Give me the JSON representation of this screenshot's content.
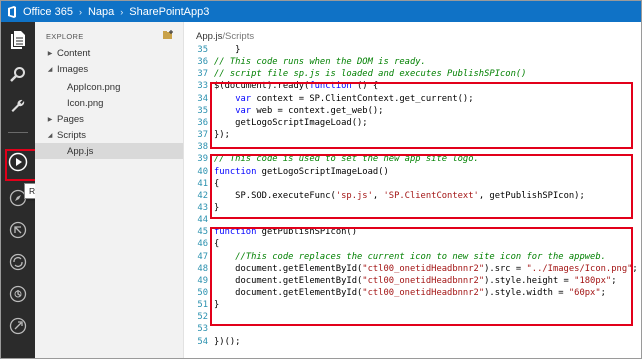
{
  "topbar": {
    "crumbs": [
      "Office 365",
      "Napa",
      "SharePointApp3"
    ]
  },
  "rail": {
    "icons": [
      "files-icon",
      "search-icon",
      "wrench-icon",
      "run-icon",
      "compass-icon",
      "publish-icon",
      "sync-icon",
      "history-icon",
      "settings-icon"
    ]
  },
  "explorer": {
    "title": "EXPLORE",
    "tree": [
      {
        "label": "Content",
        "arrow": "▶",
        "indent": 0
      },
      {
        "label": "Images",
        "arrow": "◢",
        "indent": 0
      },
      {
        "label": "AppIcon.png",
        "arrow": "",
        "indent": 1
      },
      {
        "label": "Icon.png",
        "arrow": "",
        "indent": 1
      },
      {
        "label": "Pages",
        "arrow": "▶",
        "indent": 0
      },
      {
        "label": "Scripts",
        "arrow": "◢",
        "indent": 0
      },
      {
        "label": "App.js",
        "arrow": "",
        "indent": 1,
        "selected": true
      }
    ]
  },
  "tooltip": "Run Project",
  "editor": {
    "file": "App.js",
    "path": "/Scripts",
    "lines": [
      {
        "n": "35",
        "segs": [
          [
            "",
            "    }"
          ]
        ]
      },
      {
        "n": "36",
        "segs": [
          [
            "cm",
            "// This code runs when the DOM is ready."
          ]
        ]
      },
      {
        "n": "37",
        "segs": [
          [
            "cm",
            "// script file sp.js is loaded and executes PublishSPIcon()"
          ]
        ]
      },
      {
        "n": "33",
        "segs": [
          [
            "",
            "$(document).ready("
          ],
          [
            "kw",
            "function"
          ],
          [
            "",
            " () {"
          ]
        ]
      },
      {
        "n": "34",
        "segs": [
          [
            "",
            "    "
          ],
          [
            "kw",
            "var"
          ],
          [
            "",
            " context = SP.ClientContext.get_current();"
          ]
        ]
      },
      {
        "n": "35",
        "segs": [
          [
            "",
            "    "
          ],
          [
            "kw",
            "var"
          ],
          [
            "",
            " web = context.get_web();"
          ]
        ]
      },
      {
        "n": "36",
        "segs": [
          [
            "",
            "    getLogoScriptImageLoad();"
          ]
        ]
      },
      {
        "n": "37",
        "segs": [
          [
            "",
            "});"
          ]
        ]
      },
      {
        "n": "38",
        "segs": [
          [
            "",
            ""
          ]
        ]
      },
      {
        "n": "39",
        "segs": [
          [
            "cm",
            "// This code is used to set the new app site logo."
          ]
        ]
      },
      {
        "n": "40",
        "segs": [
          [
            "kw",
            "function"
          ],
          [
            "",
            " getLogoScriptImageLoad()"
          ]
        ]
      },
      {
        "n": "41",
        "segs": [
          [
            "",
            "{"
          ]
        ]
      },
      {
        "n": "42",
        "segs": [
          [
            "",
            "    SP.SOD.executeFunc("
          ],
          [
            "str",
            "'sp.js'"
          ],
          [
            "",
            ", "
          ],
          [
            "str",
            "'SP.ClientContext'"
          ],
          [
            "",
            ", getPublishSPIcon);"
          ]
        ]
      },
      {
        "n": "43",
        "segs": [
          [
            "",
            "}"
          ]
        ]
      },
      {
        "n": "44",
        "segs": [
          [
            "",
            ""
          ]
        ]
      },
      {
        "n": "45",
        "segs": [
          [
            "kw",
            "function"
          ],
          [
            "",
            " getPublishSPIcon()"
          ]
        ]
      },
      {
        "n": "46",
        "segs": [
          [
            "",
            "{"
          ]
        ]
      },
      {
        "n": "47",
        "segs": [
          [
            "",
            "    "
          ],
          [
            "cm",
            "//This code replaces the current icon to new site icon for the appweb."
          ]
        ]
      },
      {
        "n": "48",
        "segs": [
          [
            "",
            "    document.getElementById("
          ],
          [
            "str",
            "\"ctl00_onetidHeadbnnr2\""
          ],
          [
            "",
            ").src = "
          ],
          [
            "str",
            "\"../Images/Icon.png\""
          ],
          [
            "",
            ";"
          ]
        ]
      },
      {
        "n": "49",
        "segs": [
          [
            "",
            "    document.getElementById("
          ],
          [
            "str",
            "\"ctl00_onetidHeadbnnr2\""
          ],
          [
            "",
            ").style.height = "
          ],
          [
            "str",
            "\"180px\""
          ],
          [
            "",
            ";"
          ]
        ]
      },
      {
        "n": "50",
        "segs": [
          [
            "",
            "    document.getElementById("
          ],
          [
            "str",
            "\"ctl00_onetidHeadbnnr2\""
          ],
          [
            "",
            ").style.width = "
          ],
          [
            "str",
            "\"60px\""
          ],
          [
            "",
            ";"
          ]
        ]
      },
      {
        "n": "51",
        "segs": [
          [
            "",
            "}"
          ]
        ]
      },
      {
        "n": "52",
        "segs": [
          [
            "",
            ""
          ]
        ]
      },
      {
        "n": "53",
        "segs": [
          [
            "",
            ""
          ]
        ]
      },
      {
        "n": "54",
        "segs": [
          [
            "",
            "})();"
          ]
        ]
      }
    ]
  }
}
